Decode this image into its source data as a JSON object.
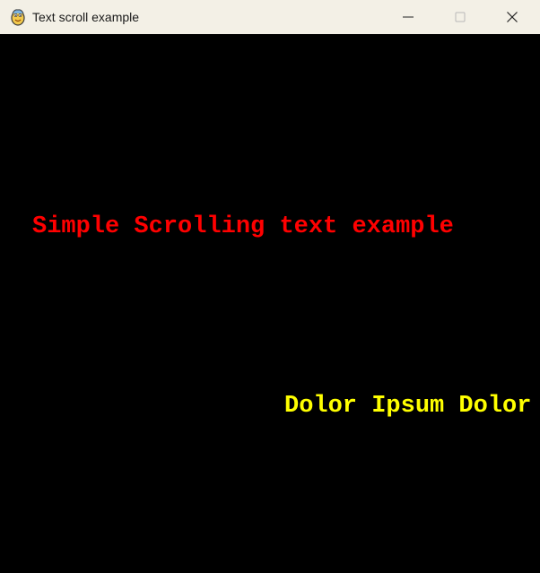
{
  "window": {
    "title": "Text scroll example",
    "app_icon": "python-snake-icon",
    "controls": {
      "minimize_icon": "minimize-icon",
      "maximize_icon": "maximize-icon",
      "close_icon": "close-icon"
    }
  },
  "canvas": {
    "background": "#000000",
    "static_text": {
      "text": "Simple Scrolling text example",
      "color": "#ff0000"
    },
    "scrolling_text": {
      "text": "Dolor Ipsum Dolor",
      "color": "#ffff00"
    }
  }
}
